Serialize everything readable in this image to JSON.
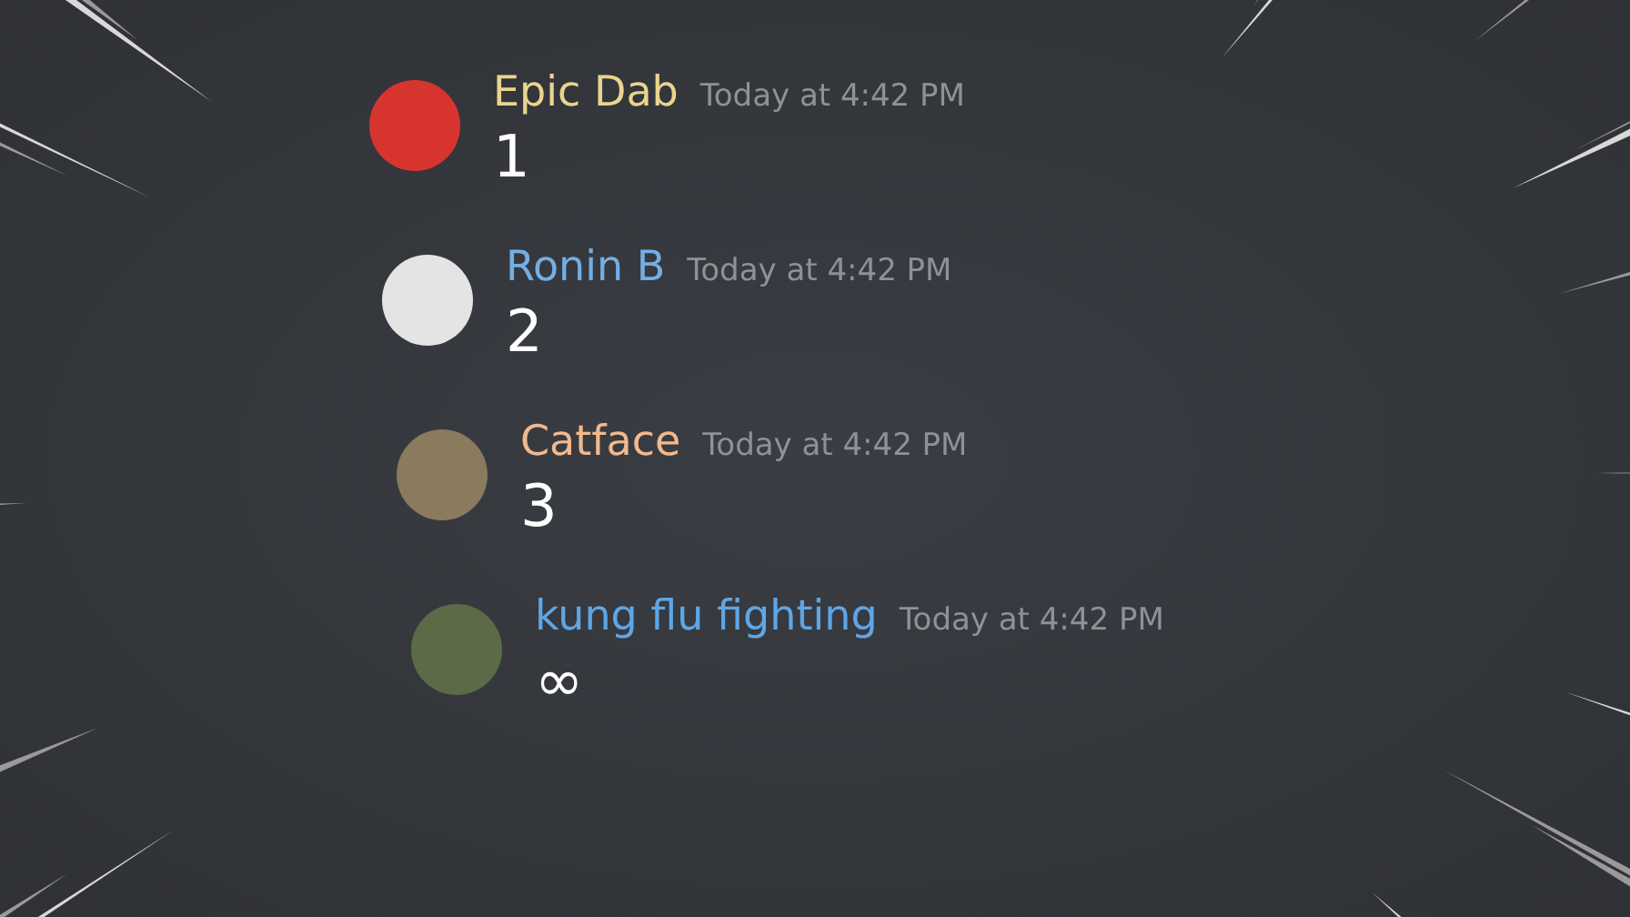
{
  "messages": [
    {
      "author": "Epic Dab",
      "color": "#e9d58c",
      "timestamp": "Today at 4:42 PM",
      "text": "1"
    },
    {
      "author": "Ronin B",
      "color": "#74aee3",
      "timestamp": "Today at 4:42 PM",
      "text": "2"
    },
    {
      "author": "Catface",
      "color": "#f2b88e",
      "timestamp": "Today at 4:42 PM",
      "text": "3"
    },
    {
      "author": "kung flu fighting",
      "color": "#5ea6e6",
      "timestamp": "Today at 4:42 PM",
      "text": "∞"
    }
  ]
}
